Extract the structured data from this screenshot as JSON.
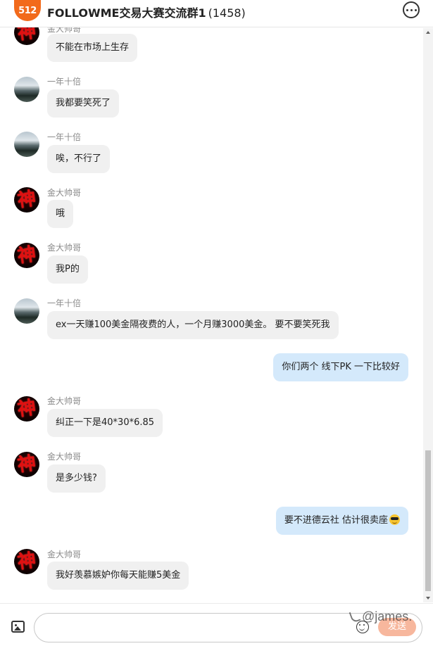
{
  "header": {
    "logo_text": "512",
    "title": "FOLLOWME交易大赛交流群1",
    "member_count": "(1458)",
    "more_icon": "more-horizontal-circle-icon"
  },
  "messages": [
    {
      "type": "in",
      "avatar": "shen",
      "name": "金大帅哥",
      "text": "不能在市场上生存"
    },
    {
      "type": "in",
      "avatar": "scene",
      "name": "一年十倍",
      "text": "我都要笑死了"
    },
    {
      "type": "in",
      "avatar": "scene",
      "name": "一年十倍",
      "text": "唉，不行了"
    },
    {
      "type": "in",
      "avatar": "shen",
      "name": "金大帅哥",
      "text": "哦"
    },
    {
      "type": "in",
      "avatar": "shen",
      "name": "金大帅哥",
      "text": "我P的"
    },
    {
      "type": "in",
      "avatar": "scene",
      "name": "一年十倍",
      "text": "ex一天赚100美金隔夜费的人，一个月赚3000美金。 要不要笑死我"
    },
    {
      "type": "out",
      "text": "你们两个 线下PK 一下比较好"
    },
    {
      "type": "in",
      "avatar": "shen",
      "name": "金大帅哥",
      "text": "纠正一下是40*30*6.85"
    },
    {
      "type": "in",
      "avatar": "shen",
      "name": "金大帅哥",
      "text": "是多少钱?"
    },
    {
      "type": "out",
      "text": "要不进德云社  估计很卖座",
      "emoji": "smiling-face-with-sunglasses"
    },
    {
      "type": "in",
      "avatar": "shen",
      "name": "金大帅哥",
      "text": "我好羡慕嫉妒你每天能赚5美金"
    }
  ],
  "avatar_glyph": "神",
  "input": {
    "placeholder": "",
    "image_icon": "image-icon",
    "emoji_icon": "emoji-icon",
    "send_label": "发送"
  },
  "watermark": "@james.",
  "colors": {
    "accent": "#f26a1b",
    "own_bubble": "#d4e9fb",
    "other_bubble": "#f0f0f0",
    "send_button": "#f7b79d"
  }
}
